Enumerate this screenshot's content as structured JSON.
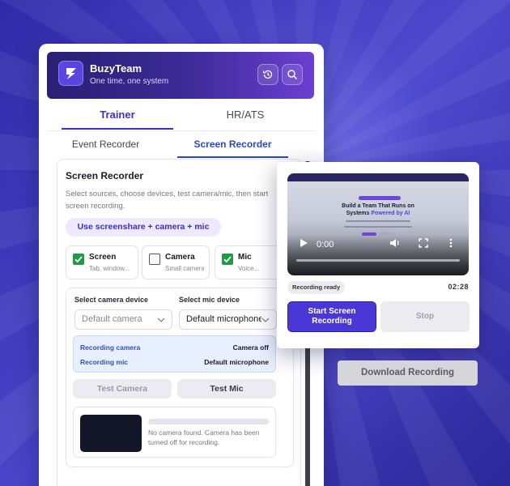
{
  "app": {
    "name": "BuzyTeam",
    "tagline": "One time, one system"
  },
  "header_buttons": [
    "history-icon",
    "search-icon"
  ],
  "main_tabs": [
    {
      "label": "Trainer",
      "active": true
    },
    {
      "label": "HR/ATS",
      "active": false
    }
  ],
  "sub_tabs": [
    {
      "label": "Event Recorder",
      "active": false
    },
    {
      "label": "Screen Recorder",
      "active": true
    }
  ],
  "recorder": {
    "title": "Screen Recorder",
    "description": "Select sources, choose devices, test camera/mic, then start screen recording.",
    "preset_label": "Use screenshare + camera + mic",
    "sources": [
      {
        "label": "Screen",
        "sub": "Tab, window...",
        "checked": true
      },
      {
        "label": "Camera",
        "sub": "Small camera",
        "checked": false
      },
      {
        "label": "Mic",
        "sub": "Voice...",
        "checked": true
      }
    ],
    "camera_device_label": "Select camera device",
    "camera_device_value": "Default camera",
    "mic_device_label": "Select mic device",
    "mic_device_value": "Default microphone",
    "status": [
      {
        "key": "Recording camera",
        "value": "Camera off"
      },
      {
        "key": "Recording mic",
        "value": "Default microphone"
      }
    ],
    "test_camera_label": "Test Camera",
    "test_mic_label": "Test Mic",
    "preview_message": "No camera found. Camera has been turned off for recording."
  },
  "floating_card": {
    "video_heading": "Build a Team That Runs on",
    "video_heading2": "Systems",
    "video_heading_accent": "Powered by AI",
    "video_time": "0:00",
    "status_badge": "Recording ready",
    "duration": "02:28",
    "start_label": "Start Screen Recording",
    "stop_label": "Stop"
  },
  "download_label": "Download Recording",
  "colors": {
    "accent": "#4a38d6",
    "active_tab": "#3b30c9",
    "check_green": "#1f9b47",
    "status_bg": "#e8f0ff"
  }
}
